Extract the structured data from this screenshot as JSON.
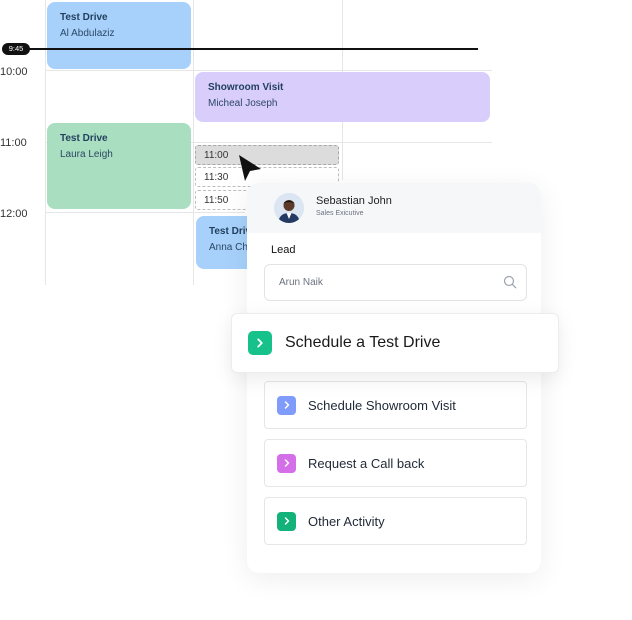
{
  "calendar": {
    "now_time": "9:45",
    "time_labels": [
      "10:00",
      "11:00",
      "12:00"
    ],
    "events": [
      {
        "title": "Test Drive",
        "name": "Al Abdulaziz"
      },
      {
        "title": "Showroom Visit",
        "name": "Micheal Joseph"
      },
      {
        "title": "Test Drive",
        "name": "Laura Leigh"
      },
      {
        "title": "Test Drive",
        "name": "Anna Chen"
      }
    ],
    "slots": [
      "11:00",
      "11:30",
      "11:50"
    ]
  },
  "card": {
    "user_name": "Sebastian John",
    "user_role": "Sales Exicutive",
    "lead_label": "Lead",
    "lead_value": "Arun Naik",
    "options": [
      {
        "label": "Schedule a Test Drive",
        "color": "#17c18a"
      },
      {
        "label": "Schedule Showroom Visit",
        "color": "#7f9bfb"
      },
      {
        "label": "Request a Call back",
        "color": "#d46ee9"
      },
      {
        "label": "Other Activity",
        "color": "#12b27a"
      }
    ]
  },
  "icons": [
    "cursor-arrow-icon",
    "search-icon",
    "chevron-right-icon"
  ]
}
